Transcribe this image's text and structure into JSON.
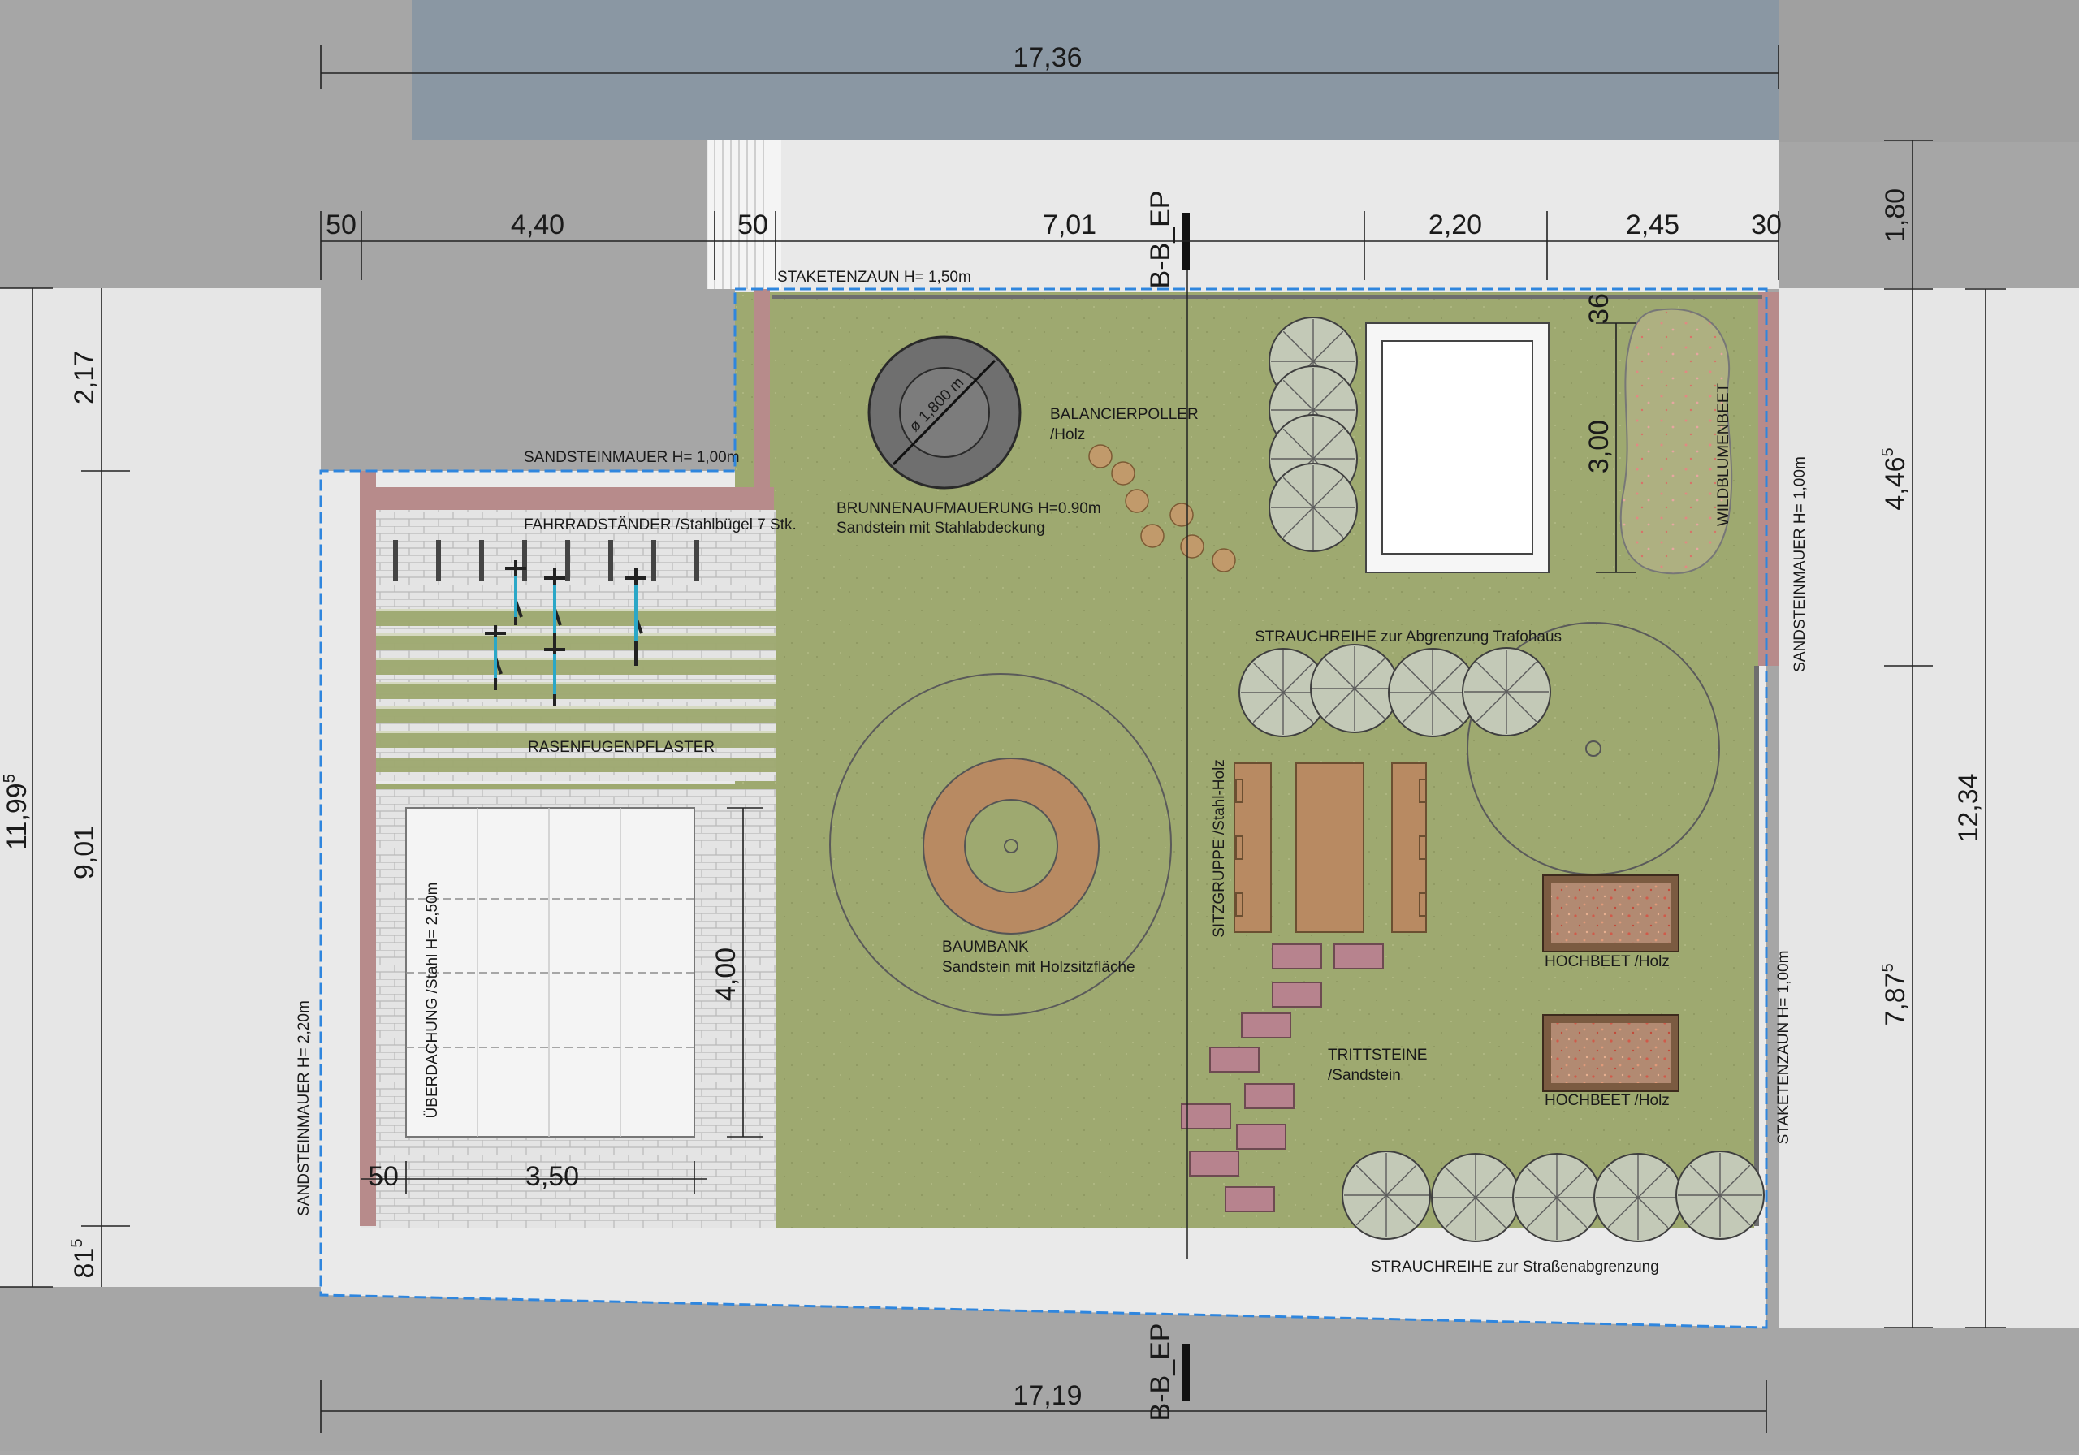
{
  "dimensions": {
    "top_total": "17,36",
    "bottom_total": "17,19",
    "top_segments": [
      "50",
      "4,40",
      "50",
      "7,01",
      "2,20",
      "2,45",
      "30"
    ],
    "left_total": "11,99",
    "left_total_sup": "5",
    "left_segments": [
      "2,17",
      "9,01",
      "81"
    ],
    "left_segment_sup": "5",
    "right_inner": [
      "1,80",
      "4,46",
      "7,87"
    ],
    "right_inner_sup": "5",
    "right_total": "12,34",
    "bikeshed_width": "3,50",
    "bikeshed_margin": "50",
    "bikeshed_depth": "4,00",
    "hochbeet_offset": "36",
    "hochbeet_length": "3,00"
  },
  "section_marker": "B-B_EP",
  "labels": {
    "staketenzaun_top": "STAKETENZAUN H= 1,50m",
    "sandsteinmauer_top": "SANDSTEINMAUER H= 1,00m",
    "fahrradstaender": "FAHRRADSTÄNDER /Stahlbügel 7 Stk.",
    "rasenfugenpflaster": "RASENFUGENPFLASTER",
    "ueberdachung": "ÜBERDACHUNG /Stahl H= 2,50m",
    "sandsteinmauer_left": "SANDSTEINMAUER H= 2,20m",
    "brunnen_diameter": "ø 1,800 m",
    "brunnen_line1": "BRUNNENAUFMAUERUNG H=0.90m",
    "brunnen_line2": "Sandstein mit Stahlabdeckung",
    "balancierpoller_line1": "BALANCIERPOLLER",
    "balancierpoller_line2": "/Holz",
    "wildblumenbeet": "WILDBLUMENBEET",
    "sandsteinmauer_right": "SANDSTEINMAUER H= 1,00m",
    "strauchreihe_trafo": "STRAUCHREIHE zur Abgrenzung Trafohaus",
    "baumbank_line1": "BAUMBANK",
    "baumbank_line2": "Sandstein mit Holzsitzfläche",
    "sitzgruppe": "SITZGRUPPE /Stahl-Holz",
    "hochbeet_1": "HOCHBEET /Holz",
    "hochbeet_2": "HOCHBEET /Holz",
    "trittsteine_line1": "TRITTSTEINE",
    "trittsteine_line2": "/Sandstein",
    "staketenzaun_right": "STAKETENZAUN H= 1,00m",
    "strauchreihe_strasse": "STRAUCHREIHE zur Straßenabgrenzung"
  },
  "colors": {
    "lawn": "#9ea970",
    "wall": "#b78b8b",
    "paving": "#e2e2e2",
    "building": "#8a97a3",
    "plot_boundary": "#2f86de",
    "wood": "#b88a62"
  }
}
